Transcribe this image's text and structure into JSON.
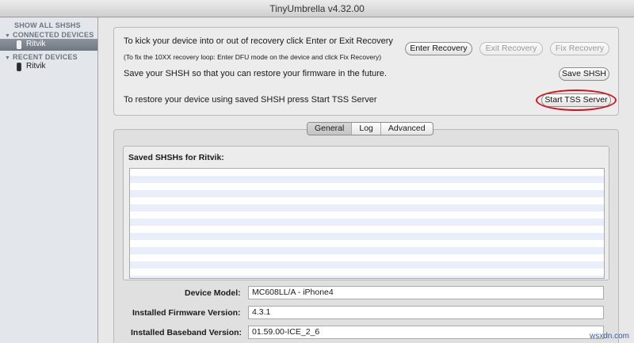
{
  "window": {
    "title": "TinyUmbrella v4.32.00"
  },
  "sidebar": {
    "show_all": "SHOW ALL SHSHS",
    "connected_header": "CONNECTED DEVICES",
    "connected_items": [
      {
        "label": "Ritvik",
        "icon": "iphone-icon"
      }
    ],
    "recent_header": "RECENT DEVICES",
    "recent_items": [
      {
        "label": "Ritvik",
        "icon": "iphone-icon"
      }
    ]
  },
  "top": {
    "recovery_text": "To kick your device into or out of recovery click Enter or Exit Recovery",
    "recovery_hint": "(To fix the 10XX recovery loop: Enter DFU mode on the device and click Fix Recovery)",
    "enter_recovery": "Enter Recovery",
    "exit_recovery": "Exit Recovery",
    "fix_recovery": "Fix Recovery",
    "save_text": "Save your SHSH so that you can restore your firmware in the future.",
    "save_shsh": "Save SHSH",
    "tss_text": "To restore your device using saved SHSH press Start TSS Server",
    "start_tss": "Start TSS Server",
    "highlight_color": "#d4121b"
  },
  "tabs": [
    {
      "label": "General",
      "active": true
    },
    {
      "label": "Log",
      "active": false
    },
    {
      "label": "Advanced",
      "active": false
    }
  ],
  "general": {
    "list_title": "Saved SHSHs for Ritvik:",
    "list_rows": [],
    "fields": {
      "device_model_label": "Device Model:",
      "device_model_value": "MC608LL/A - iPhone4",
      "firmware_label": "Installed Firmware Version:",
      "firmware_value": "4.3.1",
      "baseband_label": "Installed Baseband Version:",
      "baseband_value": "01.59.00-ICE_2_6"
    }
  },
  "watermark": "wsxdn.com"
}
